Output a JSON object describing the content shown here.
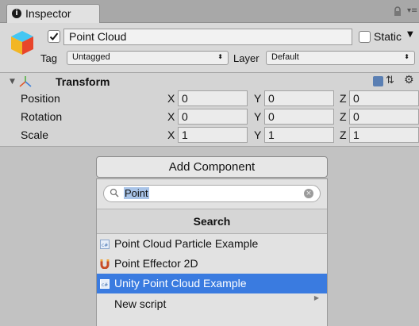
{
  "tab": {
    "label": "Inspector"
  },
  "object": {
    "name": "Point Cloud",
    "static_label": "Static",
    "tag_label": "Tag",
    "tag_value": "Untagged",
    "layer_label": "Layer",
    "layer_value": "Default"
  },
  "transform": {
    "title": "Transform",
    "rows": [
      {
        "label": "Position",
        "x": "0",
        "y": "0",
        "z": "0"
      },
      {
        "label": "Rotation",
        "x": "0",
        "y": "0",
        "z": "0"
      },
      {
        "label": "Scale",
        "x": "1",
        "y": "1",
        "z": "1"
      }
    ],
    "axes": [
      "X",
      "Y",
      "Z"
    ]
  },
  "popup": {
    "add_component_label": "Add Component",
    "search_value": "Point",
    "section_title": "Search",
    "items": [
      {
        "label": "Point Cloud Particle Example",
        "icon": "csharp-script-icon"
      },
      {
        "label": "Point Effector 2D",
        "icon": "magnet-icon"
      },
      {
        "label": "Unity Point Cloud Example",
        "icon": "csharp-script-icon",
        "selected": true
      },
      {
        "label": "New script",
        "icon": ""
      }
    ]
  },
  "colors": {
    "selection": "#3a7be0",
    "panel": "#c2c2c2"
  }
}
